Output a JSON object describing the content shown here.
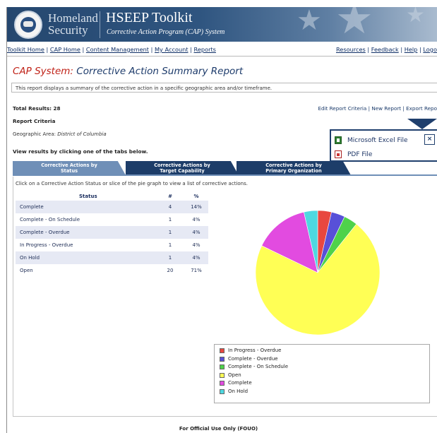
{
  "header": {
    "org_line1": "Homeland",
    "org_line2": "Security",
    "app_title": "HSEEP Toolkit",
    "app_subtitle": "Corrective Action Program (CAP) System"
  },
  "topnav": {
    "left": [
      "Toolkit Home",
      "CAP Home",
      "Content Management",
      "My Account",
      "Reports"
    ],
    "right": [
      "Resources",
      "Feedback",
      "Help",
      "Logo"
    ]
  },
  "page": {
    "title_prefix": "CAP System:",
    "title_main": "Corrective Action Summary Report",
    "description": "This report displays a summary of the corrective action in a specific geographic area and/or timeframe.",
    "total_results": "Total Results: 28",
    "actions": [
      "Edit Report Criteria",
      "New Report",
      "Export Repo"
    ],
    "report_criteria_label": "Report Criteria",
    "geo_label": "Geographic Area:",
    "geo_value": "District of Columbia",
    "view_hint": "View results by clicking one of the tabs below."
  },
  "tabs": [
    {
      "line1": "Corrective Actions by",
      "line2": "Status"
    },
    {
      "line1": "Corrective Actions by",
      "line2": "Target Capability"
    },
    {
      "line1": "Corrective Actions by",
      "line2": "Primary Organization"
    }
  ],
  "instruction": "Click on a Corrective Action Status or slice of the pie graph to view a list of corrective actions.",
  "status_table": {
    "headers": [
      "Status",
      "#",
      "%"
    ],
    "rows": [
      {
        "status": "Complete",
        "count": "4",
        "pct": "14%"
      },
      {
        "status": "Complete - On Schedule",
        "count": "1",
        "pct": "4%"
      },
      {
        "status": "Complete - Overdue",
        "count": "1",
        "pct": "4%"
      },
      {
        "status": "In Progress - Overdue",
        "count": "1",
        "pct": "4%"
      },
      {
        "status": "On Hold",
        "count": "1",
        "pct": "4%"
      },
      {
        "status": "Open",
        "count": "20",
        "pct": "71%"
      }
    ]
  },
  "chart_data": {
    "type": "pie",
    "slices": [
      {
        "label": "In Progress - Overdue",
        "value": 1,
        "color": "#e8473f"
      },
      {
        "label": "Complete - Overdue",
        "value": 1,
        "color": "#5850d8"
      },
      {
        "label": "Complete - On Schedule",
        "value": 1,
        "color": "#4fd24a"
      },
      {
        "label": "Open",
        "value": 20,
        "color": "#ffff55"
      },
      {
        "label": "Complete",
        "value": 4,
        "color": "#e24be0"
      },
      {
        "label": "On Hold",
        "value": 1,
        "color": "#4ed8e0"
      }
    ]
  },
  "export_popup": {
    "excel": "Microsoft Excel File",
    "pdf": "PDF File",
    "close": "×"
  },
  "footer": "For Official Use Only (FOUO)"
}
